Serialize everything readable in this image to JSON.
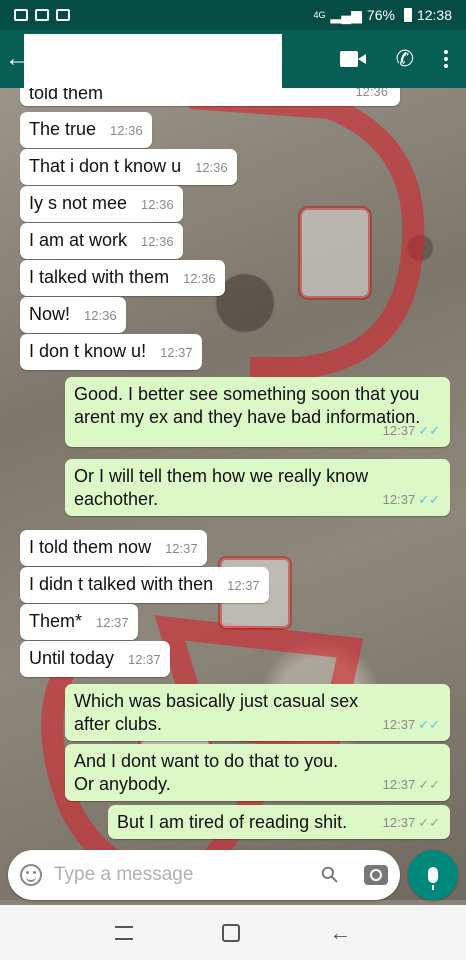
{
  "status_bar": {
    "network": "4G",
    "battery": "76%",
    "time": "12:38"
  },
  "header": {
    "back": "←",
    "phone_glyph": "✆"
  },
  "messages": [
    {
      "dir": "in",
      "text": "told them",
      "time": "12:36"
    },
    {
      "dir": "in",
      "text": "The true",
      "time": "12:36"
    },
    {
      "dir": "in",
      "text": "That i don t know u",
      "time": "12:36"
    },
    {
      "dir": "in",
      "text": "Iy s not mee",
      "time": "12:36"
    },
    {
      "dir": "in",
      "text": "I am at work",
      "time": "12:36"
    },
    {
      "dir": "in",
      "text": "I talked with them",
      "time": "12:36"
    },
    {
      "dir": "in",
      "text": "Now!",
      "time": "12:36"
    },
    {
      "dir": "in",
      "text": "I don t know u!",
      "time": "12:37"
    },
    {
      "dir": "out",
      "text": "Good. I better see something soon that you arent my ex and they have bad information.",
      "time": "12:37",
      "tick": "✓✓",
      "read": true
    },
    {
      "dir": "out",
      "text": "Or I will tell them how we really know eachother.",
      "time": "12:37",
      "tick": "✓✓",
      "read": true
    },
    {
      "dir": "in",
      "text": "I told them now",
      "time": "12:37"
    },
    {
      "dir": "in",
      "text": "I didn t talked with then",
      "time": "12:37"
    },
    {
      "dir": "in",
      "text": "Them*",
      "time": "12:37"
    },
    {
      "dir": "in",
      "text": "Until today",
      "time": "12:37"
    },
    {
      "dir": "out",
      "text": "Which was basically just casual sex after clubs.",
      "time": "12:37",
      "tick": "✓✓",
      "read": true
    },
    {
      "dir": "out",
      "text": "And I dont want to do that to you. Or anybody.",
      "time": "12:37",
      "tick": "✓✓",
      "read": false
    },
    {
      "dir": "out",
      "text": "But I am tired of reading shit.",
      "time": "12:37",
      "tick": "✓✓",
      "read": false
    }
  ],
  "composer": {
    "placeholder": "Type a message",
    "attach_glyph": "⚲"
  },
  "nav": {
    "back_glyph": "←"
  },
  "colors": {
    "header": "#075e54",
    "status": "#054d44",
    "incoming": "#ffffff",
    "outgoing": "#dcf8c6",
    "read_tick": "#4fc3f7",
    "fab": "#00897b"
  }
}
